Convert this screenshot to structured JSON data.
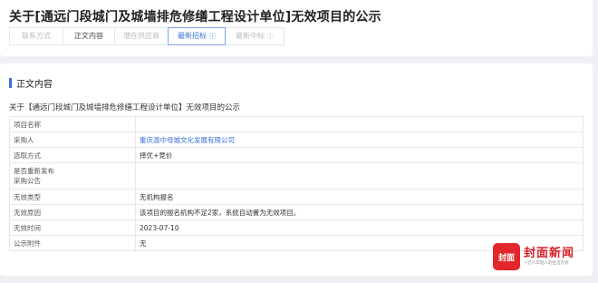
{
  "page": {
    "title": "关于[通远门段城门及城墙排危修缮工程设计单位]无效项目的公示"
  },
  "tabs": [
    {
      "label": "联系方式",
      "icon": ""
    },
    {
      "label": "正文内容",
      "icon": ""
    },
    {
      "label": "潜在供应商",
      "icon": ""
    },
    {
      "label": "最新招标",
      "icon": "ⓘ"
    },
    {
      "label": "最新中标",
      "icon": "ⓘ"
    }
  ],
  "section": {
    "title": "正文内容",
    "accent_color": "#3b72d9"
  },
  "subtitle": "关于【通远门段城门及城墙排危修缮工程设计单位】无效项目的公示",
  "details": {
    "rows": [
      {
        "key": "项目名称",
        "value": ""
      },
      {
        "key": "采购人",
        "value": "重庆渝中母城文化发展有限公司"
      },
      {
        "key": "选取方式",
        "value": "择优+竞价"
      },
      {
        "key": "是否重新发布\n采购公告",
        "value": ""
      },
      {
        "key": "无效类型",
        "value": "无机构报名"
      },
      {
        "key": "无效原因",
        "value": "该项目的报名机构不足2家，系统自动置为无效项目。"
      },
      {
        "key": "无效时间",
        "value": "2023-07-10"
      },
      {
        "key": "公示附件",
        "value": "无"
      }
    ]
  },
  "watermark": {
    "logo_text": "封面",
    "name": "封面新闻",
    "slogan": "一亿人年轻人的生活方式",
    "color": "#e3262b"
  }
}
